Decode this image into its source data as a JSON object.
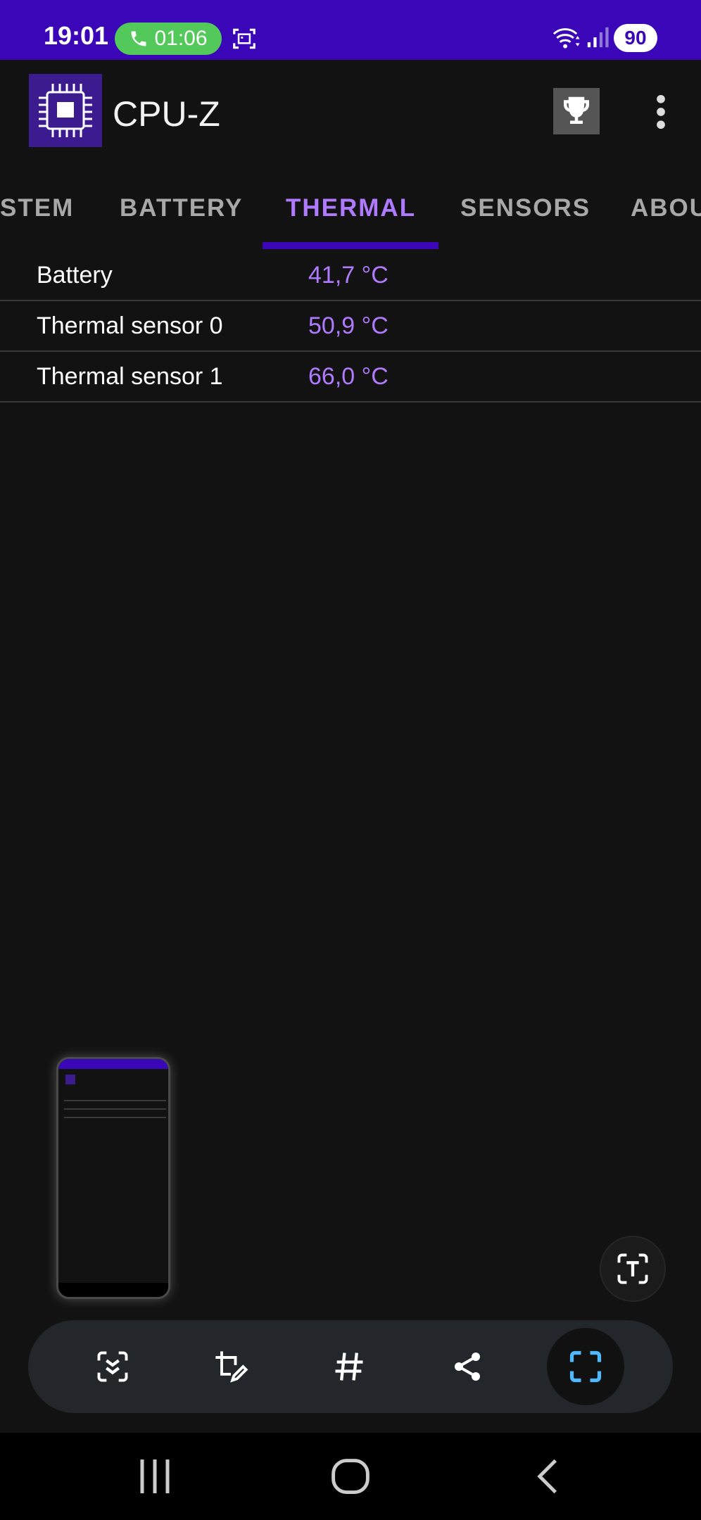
{
  "status_bar": {
    "time": "19:01",
    "call_duration": "01:06",
    "battery_level": "90",
    "background": "#3a06b8"
  },
  "app_bar": {
    "title": "CPU-Z",
    "icons": [
      "cpu-chip-logo-icon",
      "trophy-icon",
      "more-vert-icon"
    ]
  },
  "tabs": [
    {
      "label": "STEM",
      "active": false
    },
    {
      "label": "BATTERY",
      "active": false
    },
    {
      "label": "THERMAL",
      "active": true
    },
    {
      "label": "SENSORS",
      "active": false
    },
    {
      "label": "ABOU",
      "active": false
    }
  ],
  "thermal_rows": [
    {
      "label": "Battery",
      "value": "41,7 °C"
    },
    {
      "label": "Thermal sensor 0",
      "value": "50,9 °C"
    },
    {
      "label": "Thermal sensor 1",
      "value": "66,0 °C"
    }
  ],
  "screenshot_toolbar": {
    "icons": [
      "scroll-capture-icon",
      "crop-edit-icon",
      "hashtag-icon",
      "share-icon",
      "capture-area-icon"
    ]
  },
  "nav_bar": {
    "icons": [
      "recents-icon",
      "home-icon",
      "back-icon"
    ]
  },
  "colors": {
    "accent": "#b07aff",
    "indicator": "#3a06b8",
    "call_pill": "#52c95a"
  }
}
